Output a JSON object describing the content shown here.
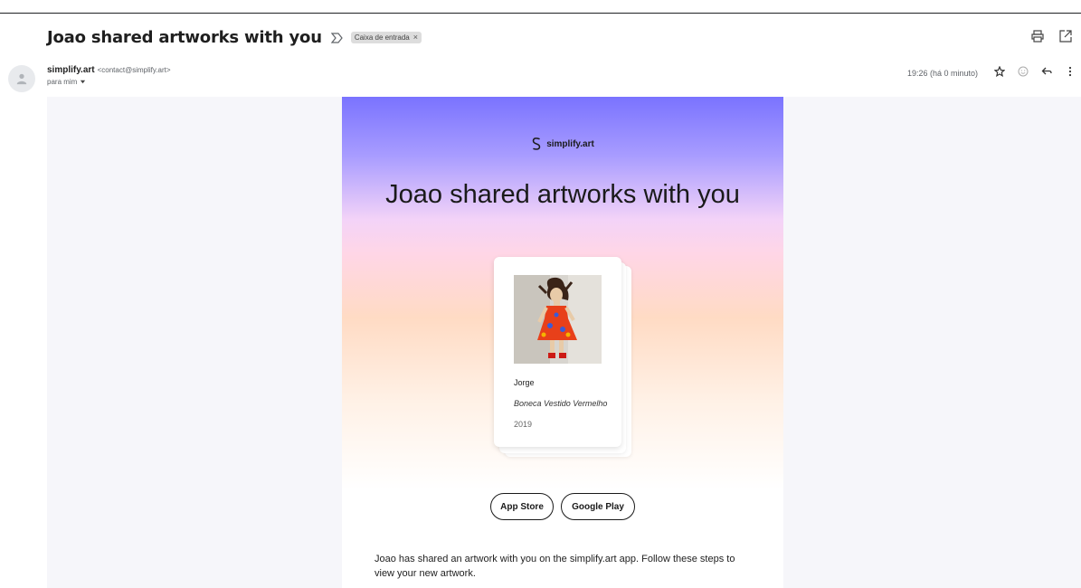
{
  "subject": "Joao shared artworks with you",
  "label_chip": {
    "text": "Caixa de entrada",
    "close": "×"
  },
  "sender": {
    "name": "simplify.art",
    "email": "<contact@simplify.art>",
    "to": "para mim"
  },
  "timestamp": "19:26 (há 0 minuto)",
  "icons": {
    "important": "important-marker-icon",
    "print": "print-icon",
    "open_new": "open-in-new-window-icon",
    "star": "star-icon",
    "emoji": "emoji-reaction-icon",
    "reply": "reply-icon",
    "more": "more-vertical-icon",
    "avatar": "person-icon",
    "dropdown": "caret-down-icon"
  },
  "email": {
    "brand": "simplify.art",
    "hero_title": "Joao shared artworks with you",
    "artwork": {
      "artist": "Jorge",
      "title": "Boneca Vestido Vermelho",
      "year": "2019"
    },
    "buttons": {
      "app_store": "App Store",
      "google_play": "Google Play"
    },
    "body_text": "Joao has shared an artwork with you on the simplify.art app. Follow these steps to view your new artwork."
  },
  "colors": {
    "gradient_top": "#7a73ff",
    "gradient_mid": "#ffd6e6",
    "gradient_peach": "#ffdbc4",
    "text_dark": "#1a1a1a",
    "page_bg": "#f6f6fa"
  }
}
